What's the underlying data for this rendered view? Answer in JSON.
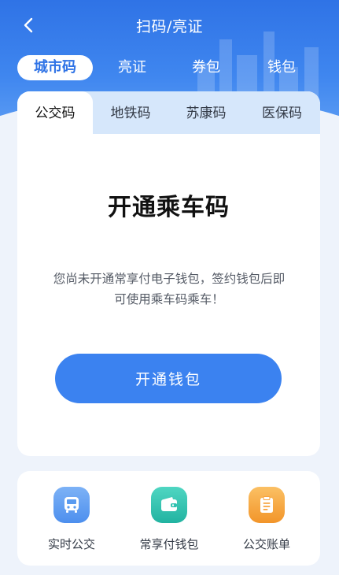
{
  "nav": {
    "title": "扫码/亮证"
  },
  "top_tabs": [
    {
      "label": "城市码",
      "active": true
    },
    {
      "label": "亮证"
    },
    {
      "label": "券包"
    },
    {
      "label": "钱包"
    }
  ],
  "sub_tabs": [
    {
      "label": "公交码",
      "active": true
    },
    {
      "label": "地铁码"
    },
    {
      "label": "苏康码"
    },
    {
      "label": "医保码"
    }
  ],
  "card": {
    "title": "开通乘车码",
    "description": "您尚未开通常享付电子钱包，签约钱包后即可使用乘车码乘车！",
    "button_label": "开通钱包"
  },
  "services": [
    {
      "label": "实时公交",
      "icon": "bus-icon",
      "color": "#5a9bf0"
    },
    {
      "label": "常享付钱包",
      "icon": "wallet-icon",
      "color": "#2ec2b0"
    },
    {
      "label": "公交账单",
      "icon": "bill-icon",
      "color": "#f7a23b"
    }
  ],
  "colors": {
    "primary": "#2f73e6",
    "button": "#3b82f0"
  }
}
